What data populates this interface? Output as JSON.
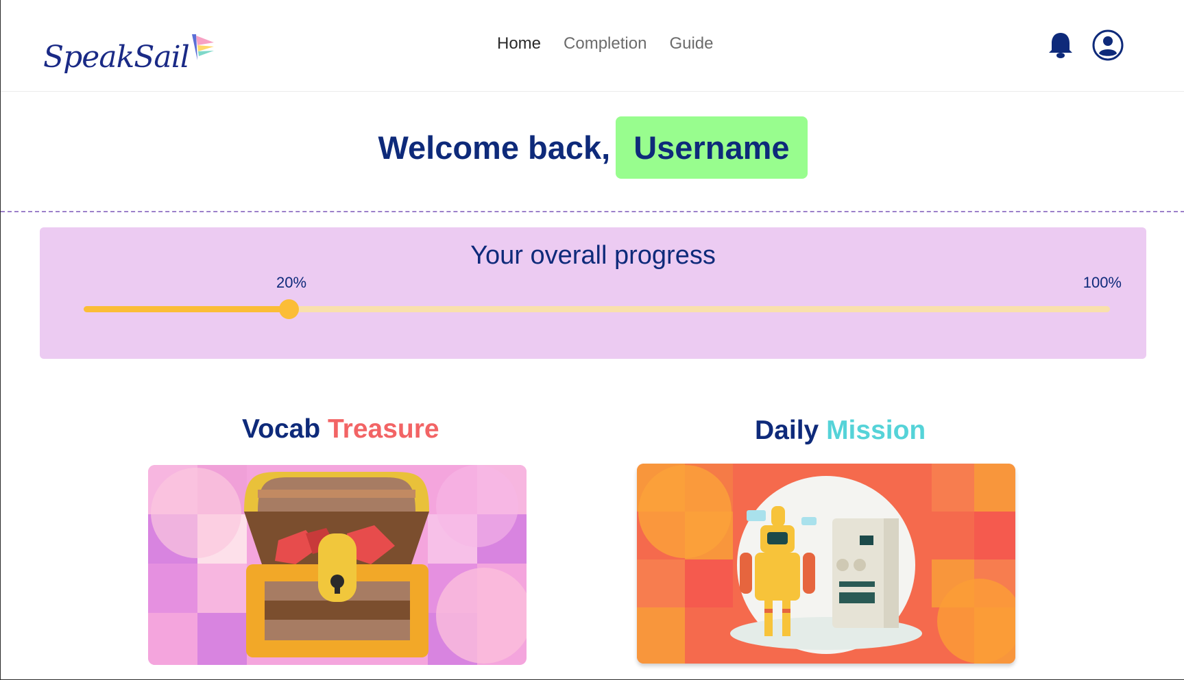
{
  "header": {
    "logo_text": "SpeakSail",
    "nav": [
      {
        "label": "Home",
        "active": true
      },
      {
        "label": "Completion",
        "active": false
      },
      {
        "label": "Guide",
        "active": false
      }
    ],
    "icons": {
      "notifications": "bell-icon",
      "account": "account-circle-icon"
    }
  },
  "welcome": {
    "greeting": "Welcome back,",
    "username": "Username"
  },
  "progress": {
    "title": "Your overall progress",
    "current_label": "20%",
    "max_label": "100%",
    "value_percent": 20
  },
  "cards": {
    "vocab": {
      "title_part1": "Vocab",
      "title_part2": "Treasure"
    },
    "mission": {
      "title_part1": "Daily",
      "title_part2": "Mission"
    }
  },
  "colors": {
    "brand_navy": "#0e2a7a",
    "username_highlight": "#98fd8e",
    "progress_card_bg": "#eccbf2",
    "progress_fill": "#fbbd37",
    "progress_track": "#f9e0ac",
    "accent_red": "#f26465",
    "accent_teal": "#55d3d8"
  }
}
